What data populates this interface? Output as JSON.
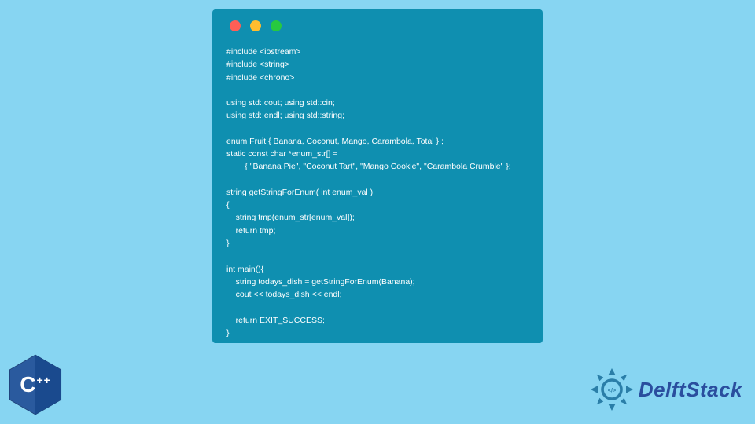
{
  "code_lines": [
    "#include <iostream>",
    "#include <string>",
    "#include <chrono>",
    "",
    "using std::cout; using std::cin;",
    "using std::endl; using std::string;",
    "",
    "enum Fruit { Banana, Coconut, Mango, Carambola, Total } ;",
    "static const char *enum_str[] =",
    "        { \"Banana Pie\", \"Coconut Tart\", \"Mango Cookie\", \"Carambola Crumble\" };",
    "",
    "string getStringForEnum( int enum_val )",
    "{",
    "    string tmp(enum_str[enum_val]);",
    "    return tmp;",
    "}",
    "",
    "int main(){",
    "    string todays_dish = getStringForEnum(Banana);",
    "    cout << todays_dish << endl;",
    "",
    "    return EXIT_SUCCESS;",
    "}"
  ],
  "logos": {
    "cpp_letter": "C",
    "cpp_plusplus": "++",
    "brand_name": "DelftStack"
  },
  "colors": {
    "window_bg": "#0f8fb0",
    "page_bg": "#87d5f2",
    "red": "#ff5f56",
    "yellow": "#ffbd2e",
    "green": "#27c93f"
  }
}
